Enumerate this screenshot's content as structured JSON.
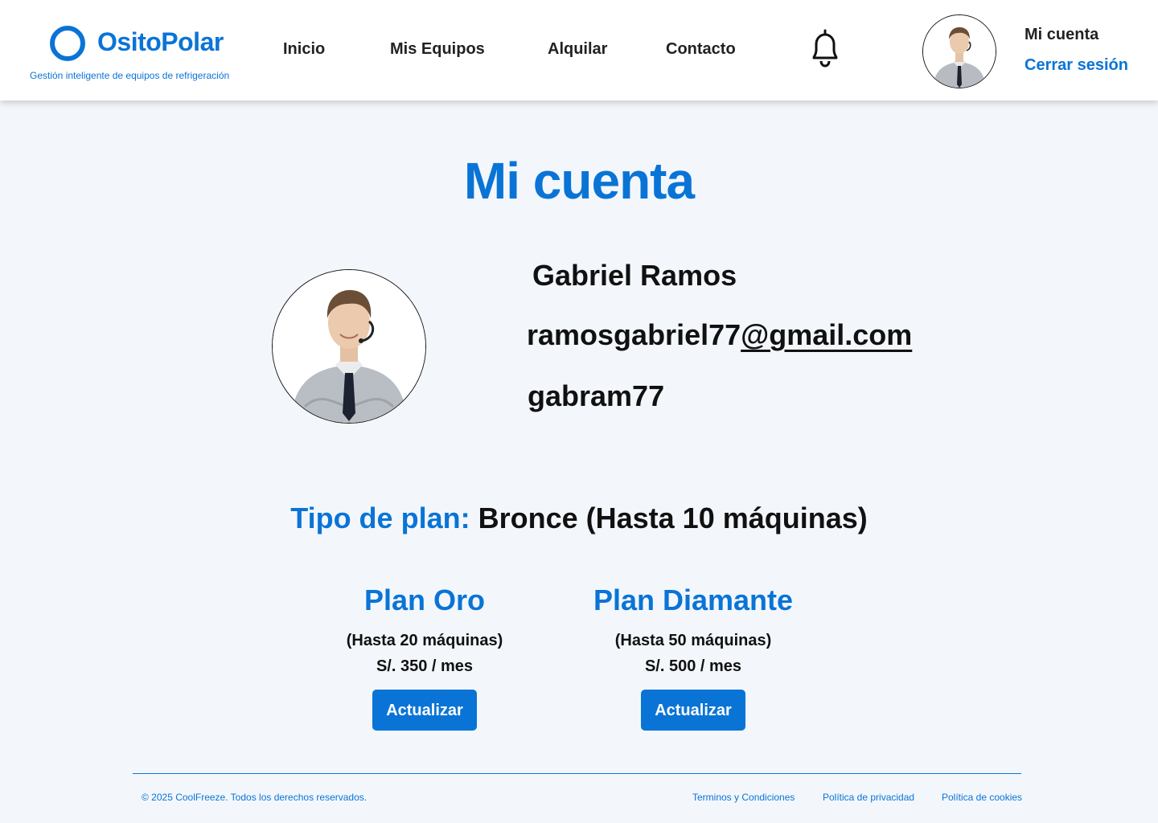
{
  "header": {
    "logo_text": "OsitoPolar",
    "tagline": "Gestión inteligente de equipos de refrigeración",
    "nav": [
      {
        "label": "Inicio"
      },
      {
        "label": "Mis Equipos"
      },
      {
        "label": "Alquilar"
      },
      {
        "label": "Contacto"
      }
    ],
    "account_label": "Mi cuenta",
    "logout_label": "Cerrar sesión"
  },
  "main": {
    "title": "Mi cuenta",
    "user": {
      "name": "Gabriel Ramos",
      "email_local": "ramosgabriel77",
      "email_domain": "@gmail.com",
      "username": "gabram77"
    },
    "current_plan": {
      "label": "Tipo de plan:",
      "value": "Bronce (Hasta 10 máquinas)"
    },
    "plans": [
      {
        "name": "Plan Oro",
        "limit": "(Hasta 20 máquinas)",
        "price": "S/. 350 / mes",
        "button": "Actualizar"
      },
      {
        "name": "Plan Diamante",
        "limit": "(Hasta 50 máquinas)",
        "price": "S/. 500 / mes",
        "button": "Actualizar"
      }
    ]
  },
  "footer": {
    "copyright": "© 2025 CoolFreeze. Todos los derechos reservados.",
    "links": [
      {
        "label": "Terminos y Condiciones"
      },
      {
        "label": "Política de privacidad"
      },
      {
        "label": "Política de cookies"
      }
    ]
  },
  "icons": {
    "logo": "ring-logo-icon",
    "notifications": "bell-icon",
    "avatar": "user-avatar"
  },
  "colors": {
    "accent": "#0a74d6",
    "background": "#f3f7fc",
    "header_bg": "#ffffff"
  }
}
